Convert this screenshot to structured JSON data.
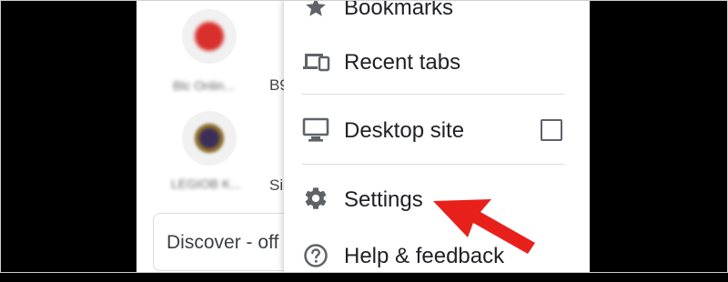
{
  "tiles": [
    {
      "label": "Blc Onlin...",
      "side_label": "B9"
    },
    {
      "label": "LEGIOB K...",
      "side_label": "Si"
    }
  ],
  "discover": {
    "label": "Discover - off"
  },
  "menu": {
    "bookmarks": "Bookmarks",
    "recent_tabs": "Recent tabs",
    "desktop_site": "Desktop site",
    "desktop_site_checked": false,
    "settings": "Settings",
    "help_feedback": "Help & feedback"
  },
  "colors": {
    "icon_gray": "#5f6368",
    "arrow_red": "#e8201b"
  }
}
